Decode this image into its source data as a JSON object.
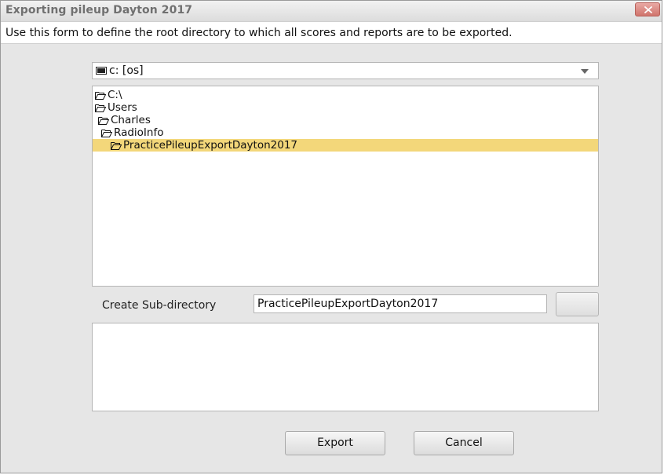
{
  "window": {
    "title": "Exporting pileup Dayton 2017"
  },
  "instructions": "Use this form to define the root directory to which all scores and reports are to be exported.",
  "drive_select": {
    "value": "c: [os]"
  },
  "directory_tree": {
    "items": [
      {
        "label": "C:\\",
        "level": 0,
        "selected": false
      },
      {
        "label": "Users",
        "level": 0,
        "selected": false
      },
      {
        "label": "Charles",
        "level": 1,
        "selected": false
      },
      {
        "label": "RadioInfo",
        "level": 2,
        "selected": false
      },
      {
        "label": "PracticePileupExportDayton2017",
        "level": 3,
        "selected": true
      }
    ]
  },
  "subdirectory": {
    "label": "Create Sub-directory",
    "value": "PracticePileupExportDayton2017"
  },
  "buttons": {
    "export": "Export",
    "cancel": "Cancel"
  },
  "colors": {
    "selection": "#f3d77a",
    "dialog_bg": "#e6e6e6",
    "close_button": "#d0746c"
  }
}
